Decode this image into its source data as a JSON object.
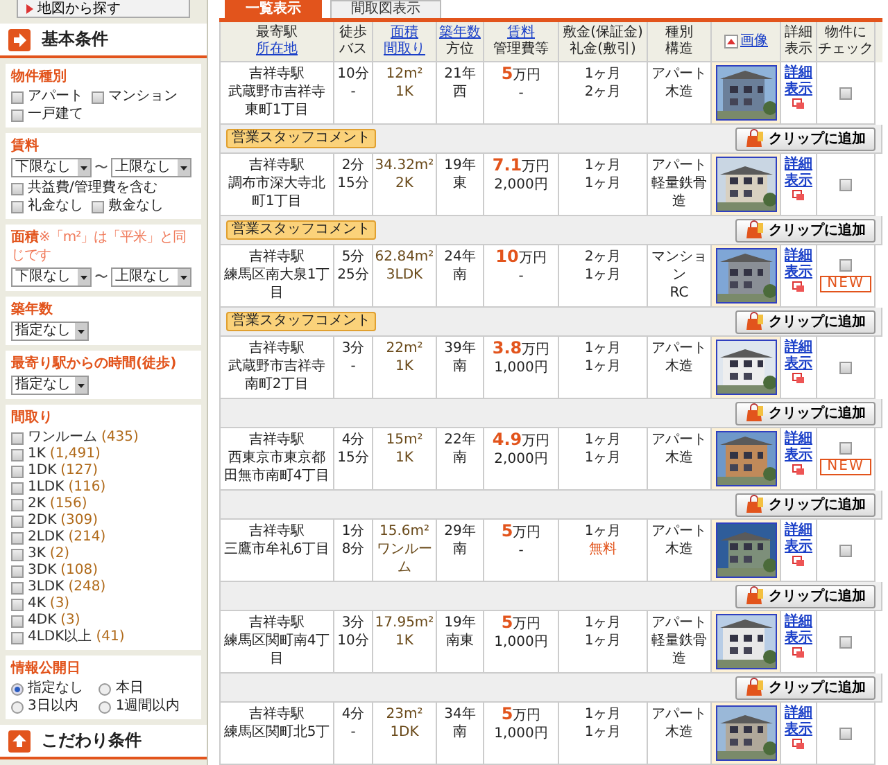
{
  "sidebar": {
    "map_button": "地図から探す",
    "section_title": "基本条件",
    "groups": [
      {
        "kind": "checkboxes",
        "title": "物件種別",
        "options": [
          {
            "label": "アパート",
            "checked": false
          },
          {
            "label": "マンション",
            "checked": false
          },
          {
            "label": "一戸建て",
            "checked": false
          }
        ]
      },
      {
        "kind": "range",
        "title": "賃料",
        "from": "下限なし",
        "separator": "〜",
        "to": "上限なし",
        "options": [
          {
            "label": "共益費/管理費を含む",
            "checked": false
          },
          {
            "label": "礼金なし",
            "checked": false
          },
          {
            "label": "敷金なし",
            "checked": false
          }
        ]
      },
      {
        "kind": "range",
        "title": "面積",
        "note": "※「m²」は「平米」と同じです",
        "from": "下限なし",
        "separator": "〜",
        "to": "上限なし"
      },
      {
        "kind": "select",
        "title": "築年数",
        "value": "指定なし"
      },
      {
        "kind": "select",
        "title": "最寄り駅からの時間(徒歩)",
        "value": "指定なし"
      },
      {
        "kind": "counts",
        "title": "間取り",
        "options": [
          {
            "label": "ワンルーム",
            "count": "(435)",
            "checked": false
          },
          {
            "label": "1K",
            "count": "(1,491)",
            "checked": false
          },
          {
            "label": "1DK",
            "count": "(127)",
            "checked": false
          },
          {
            "label": "1LDK",
            "count": "(116)",
            "checked": false
          },
          {
            "label": "2K",
            "count": "(156)",
            "checked": false
          },
          {
            "label": "2DK",
            "count": "(309)",
            "checked": false
          },
          {
            "label": "2LDK",
            "count": "(214)",
            "checked": false
          },
          {
            "label": "3K",
            "count": "(2)",
            "checked": false
          },
          {
            "label": "3DK",
            "count": "(108)",
            "checked": false
          },
          {
            "label": "3LDK",
            "count": "(248)",
            "checked": false
          },
          {
            "label": "4K",
            "count": "(3)",
            "checked": false
          },
          {
            "label": "4DK",
            "count": "(3)",
            "checked": false
          },
          {
            "label": "4LDK以上",
            "count": "(41)",
            "checked": false
          }
        ]
      },
      {
        "kind": "radios",
        "title": "情報公開日",
        "options": [
          {
            "label": "指定なし",
            "selected": true
          },
          {
            "label": "本日",
            "selected": false
          },
          {
            "label": "3日以内",
            "selected": false
          },
          {
            "label": "1週間以内",
            "selected": false
          }
        ]
      }
    ],
    "next_section_title": "こだわり条件"
  },
  "tabs": [
    {
      "label": "一覧表示",
      "selected": true
    },
    {
      "label": "間取図表示",
      "selected": false
    }
  ],
  "table": {
    "columns": [
      {
        "kind": "text",
        "lines": [
          {
            "text": "最寄駅",
            "link": false
          },
          {
            "text": "所在地",
            "link": true
          }
        ]
      },
      {
        "kind": "text",
        "lines": [
          {
            "text": "徒歩",
            "link": false
          },
          {
            "text": "バス",
            "link": false
          }
        ]
      },
      {
        "kind": "text",
        "lines": [
          {
            "text": "面積",
            "link": true
          },
          {
            "text": "間取り",
            "link": true
          }
        ]
      },
      {
        "kind": "text",
        "lines": [
          {
            "text": "築年数",
            "link": true
          },
          {
            "text": "方位",
            "link": false
          }
        ]
      },
      {
        "kind": "text",
        "lines": [
          {
            "text": "賃料",
            "link": true
          },
          {
            "text": "管理費等",
            "link": false
          }
        ]
      },
      {
        "kind": "text",
        "lines": [
          {
            "text": "敷金(保証金)",
            "link": false
          },
          {
            "text": "礼金(敷引)",
            "link": false
          }
        ]
      },
      {
        "kind": "text",
        "lines": [
          {
            "text": "種別",
            "link": false
          },
          {
            "text": "構造",
            "link": false
          }
        ]
      },
      {
        "lines": [
          {
            "text": "画像",
            "link": true
          }
        ]
      },
      {
        "kind": "text",
        "lines": [
          {
            "text": "詳細",
            "link": false
          },
          {
            "text": "表示",
            "link": false
          }
        ]
      },
      {
        "kind": "text",
        "lines": [
          {
            "text": "物件に",
            "link": false
          },
          {
            "text": "チェック",
            "link": false
          }
        ]
      }
    ],
    "rows": [
      {
        "station": "吉祥寺駅",
        "address": "武蔵野市吉祥寺東町1丁目",
        "walk": "10分",
        "bus": "-",
        "area": "12m²",
        "layout": "1K",
        "age": "21年",
        "direction": "西",
        "rent": "5",
        "rent_unit": "万円",
        "fee": "-",
        "deposit": "1ヶ月",
        "key_money": "2ヶ月",
        "key_money_highlight": false,
        "type": "アパート",
        "structure": "木造",
        "detail_link": "詳細表示",
        "checked": false,
        "staff_badge": "営業スタッフコメント",
        "clip_button": "クリップに追加"
      },
      {
        "station": "吉祥寺駅",
        "address": "調布市深大寺北町1丁目",
        "walk": "2分",
        "bus": "15分",
        "area": "34.32m²",
        "layout": "2K",
        "age": "19年",
        "direction": "東",
        "rent": "7.1",
        "rent_unit": "万円",
        "fee": "2,000円",
        "deposit": "1ヶ月",
        "key_money": "1ヶ月",
        "key_money_highlight": false,
        "type": "アパート",
        "structure": "軽量鉄骨造",
        "detail_link": "詳細表示",
        "checked": false,
        "staff_badge": "営業スタッフコメント",
        "clip_button": "クリップに追加"
      },
      {
        "station": "吉祥寺駅",
        "address": "練馬区南大泉1丁目",
        "walk": "5分",
        "bus": "25分",
        "area": "62.84m²",
        "layout": "3LDK",
        "age": "24年",
        "direction": "南",
        "rent": "10",
        "rent_unit": "万円",
        "fee": "-",
        "deposit": "2ヶ月",
        "key_money": "1ヶ月",
        "key_money_highlight": false,
        "type": "マンション",
        "structure": "RC",
        "detail_link": "詳細表示",
        "checked": false,
        "badge": "NEW",
        "staff_badge": "営業スタッフコメント",
        "clip_button": "クリップに追加"
      },
      {
        "station": "吉祥寺駅",
        "address": "武蔵野市吉祥寺南町2丁目",
        "walk": "3分",
        "bus": "-",
        "area": "22m²",
        "layout": "1K",
        "age": "39年",
        "direction": "南",
        "rent": "3.8",
        "rent_unit": "万円",
        "fee": "1,000円",
        "deposit": "1ヶ月",
        "key_money": "1ヶ月",
        "key_money_highlight": false,
        "type": "アパート",
        "structure": "木造",
        "detail_link": "詳細表示",
        "checked": false,
        "clip_button": "クリップに追加"
      },
      {
        "station": "吉祥寺駅",
        "address": "西東京市東京都田無市南町4丁目",
        "walk": "4分",
        "bus": "15分",
        "area": "15m²",
        "layout": "1K",
        "age": "22年",
        "direction": "南",
        "rent": "4.9",
        "rent_unit": "万円",
        "fee": "2,000円",
        "deposit": "1ヶ月",
        "key_money": "1ヶ月",
        "key_money_highlight": false,
        "type": "アパート",
        "structure": "木造",
        "detail_link": "詳細表示",
        "checked": false,
        "badge": "NEW",
        "clip_button": "クリップに追加"
      },
      {
        "station": "吉祥寺駅",
        "address": "三鷹市牟礼6丁目",
        "walk": "1分",
        "bus": "8分",
        "area": "15.6m²",
        "layout": "ワンルーム",
        "age": "29年",
        "direction": "南",
        "rent": "5",
        "rent_unit": "万円",
        "fee": "-",
        "deposit": "1ヶ月",
        "key_money": "無料",
        "key_money_highlight": true,
        "type": "アパート",
        "structure": "木造",
        "detail_link": "詳細表示",
        "checked": false,
        "clip_button": "クリップに追加"
      },
      {
        "station": "吉祥寺駅",
        "address": "練馬区関町南4丁目",
        "walk": "3分",
        "bus": "10分",
        "area": "17.95m²",
        "layout": "1K",
        "age": "19年",
        "direction": "南東",
        "rent": "5",
        "rent_unit": "万円",
        "fee": "1,000円",
        "deposit": "1ヶ月",
        "key_money": "1ヶ月",
        "key_money_highlight": false,
        "type": "アパート",
        "structure": "軽量鉄骨造",
        "detail_link": "詳細表示",
        "checked": false,
        "clip_button": "クリップに追加"
      },
      {
        "station": "吉祥寺駅",
        "address": "練馬区関町北5丁",
        "walk": "4分",
        "bus": "-",
        "area": "23m²",
        "layout": "1DK",
        "age": "34年",
        "direction": "南",
        "rent": "5",
        "rent_unit": "万円",
        "fee": "1,000円",
        "deposit": "1ヶ月",
        "key_money": "1ヶ月",
        "key_money_highlight": false,
        "type": "アパート",
        "structure": "木造",
        "detail_link": "詳細表示",
        "checked": false
      }
    ]
  }
}
